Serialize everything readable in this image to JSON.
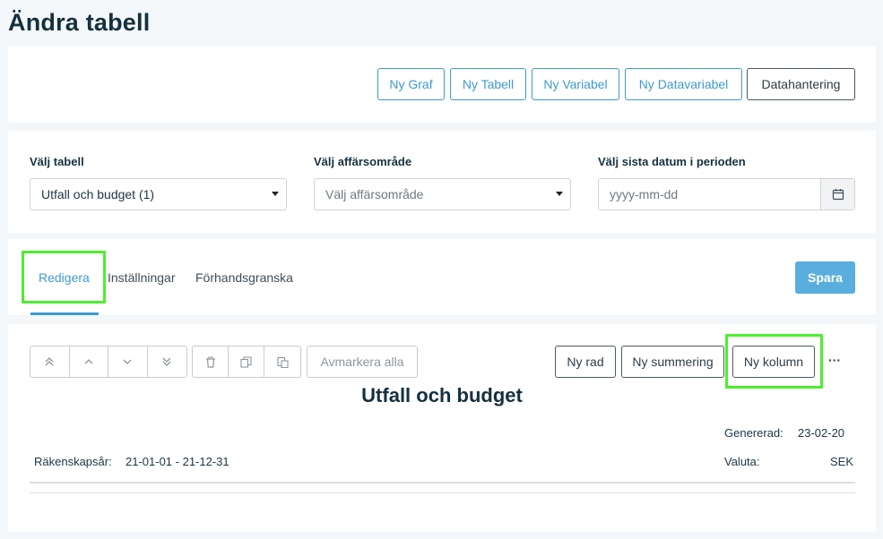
{
  "page": {
    "title": "Ändra tabell"
  },
  "toolbar": {
    "buttons": [
      "Ny Graf",
      "Ny Tabell",
      "Ny Variabel",
      "Ny Datavariabel",
      "Datahantering"
    ]
  },
  "filters": {
    "table": {
      "label": "Välj tabell",
      "value": "Utfall och budget (1)"
    },
    "business_area": {
      "label": "Välj affärsområde",
      "placeholder": "Välj affärsområde"
    },
    "date": {
      "label": "Välj sista datum i perioden",
      "placeholder": "yyyy-mm-dd"
    }
  },
  "tabs": {
    "items": [
      "Redigera",
      "Inställningar",
      "Förhandsgranska"
    ],
    "active": "Redigera",
    "save_label": "Spara"
  },
  "editor": {
    "icons": [
      "chevrons-up-icon",
      "chevron-up-icon",
      "chevron-down-icon",
      "chevrons-down-icon",
      "trash-icon",
      "copy-icon",
      "paste-icon"
    ],
    "deselect_label": "Avmarkera alla",
    "new_row_label": "Ny rad",
    "new_summary_label": "Ny summering",
    "new_column_label": "Ny kolumn",
    "more_label": "···",
    "report_title": "Utfall och budget",
    "generated_label": "Genererad:",
    "generated_value": "23-02-20",
    "fiscal_year_label": "Räkenskapsår:",
    "fiscal_year_value": "21-01-01 - 21-12-31",
    "currency_label": "Valuta:",
    "currency_value": "SEK"
  },
  "colors": {
    "accent": "#3d9ad1",
    "primary_button": "#5aaedd",
    "highlight": "#4cf02e",
    "background": "#f4f7f9"
  }
}
